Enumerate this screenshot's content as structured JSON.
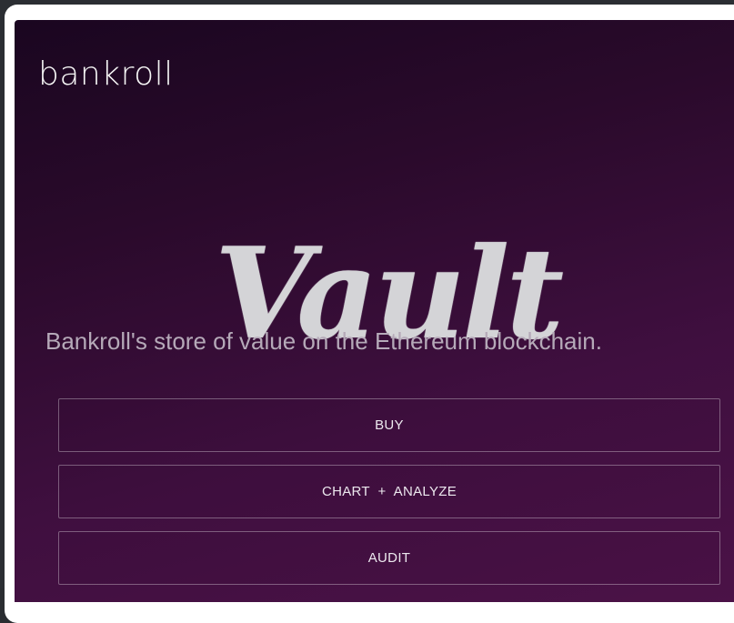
{
  "brand": {
    "name": "bankroll"
  },
  "hero": {
    "title": "Vault"
  },
  "tagline": {
    "text": "Bankroll's store of value on the Ethereum blockchain."
  },
  "actions": {
    "buy_label": "BUY",
    "chart_label": "CHART  +  ANALYZE",
    "audit_label": "AUDIT"
  },
  "colors": {
    "background_top": "#1a0620",
    "background_bottom": "#4b1247",
    "hero_text": "#d4d4d7",
    "tagline_text": "#b5a9b8",
    "button_border": "#ffffff"
  }
}
